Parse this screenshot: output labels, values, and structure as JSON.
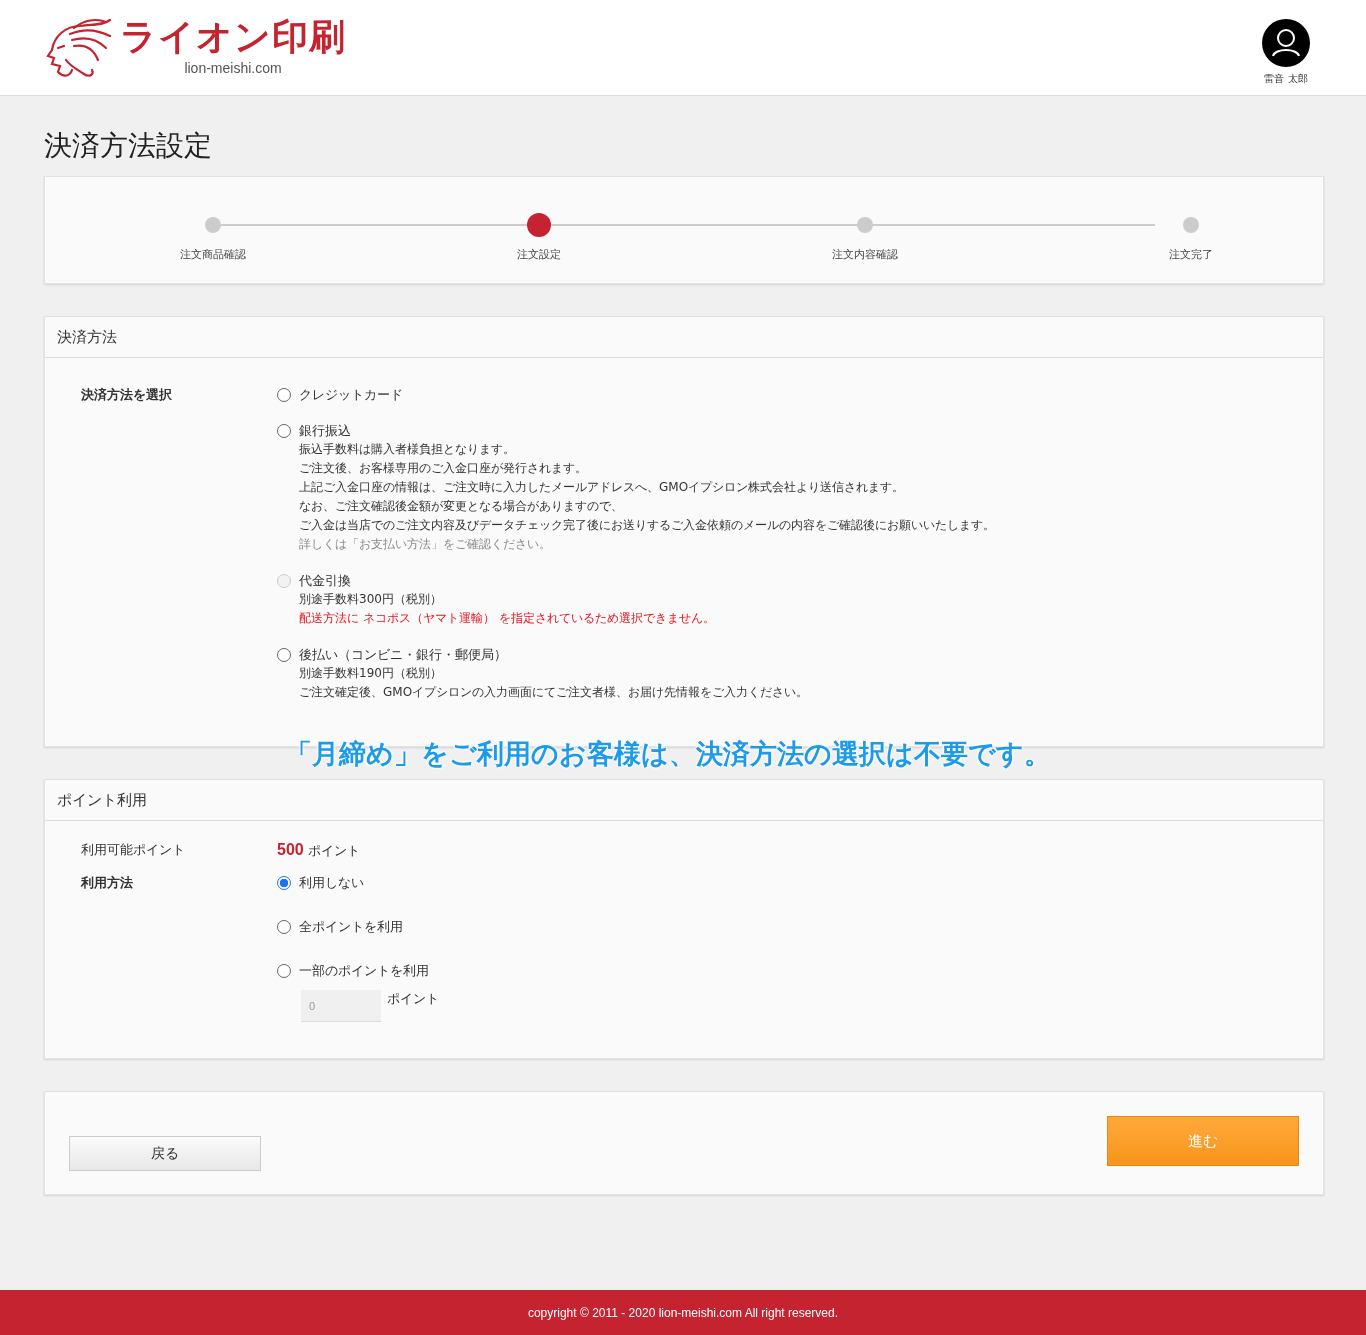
{
  "header": {
    "brand": "ライオン印刷",
    "domain": "lion-meishi.com",
    "user_name": "雷音 太郎"
  },
  "page_title": "決済方法設定",
  "steps": [
    {
      "label": "注文商品確認",
      "selected": false
    },
    {
      "label": "注文設定",
      "selected": true
    },
    {
      "label": "注文内容確認",
      "selected": false
    },
    {
      "label": "注文完了",
      "selected": false
    }
  ],
  "payment": {
    "heading": "決済方法",
    "field_label": "決済方法を選択",
    "options": [
      {
        "label": "クレジットカード",
        "selected": false,
        "disabled": false
      },
      {
        "label": "銀行振込",
        "selected": false,
        "disabled": false,
        "notes": [
          {
            "kind": "plain",
            "text": "振込手数料は購入者様負担となります。"
          },
          {
            "kind": "plain",
            "text": "ご注文後、お客様専用のご入金口座が発行されます。"
          },
          {
            "kind": "plain",
            "text": "上記ご入金口座の情報は、ご注文時に入力したメールアドレスへ、GMOイプシロン株式会社より送信されます。"
          },
          {
            "kind": "plain",
            "text": "なお、ご注文確認後金額が変更となる場合がありますので、"
          },
          {
            "kind": "plain",
            "text": "ご入金は当店でのご注文内容及びデータチェック完了後にお送りするご入金依頼のメールの内容をご確認後にお願いいたします。"
          },
          {
            "kind": "muted",
            "text": "詳しくは「お支払い方法」をご確認ください。"
          }
        ]
      },
      {
        "label": "代金引換",
        "selected": false,
        "disabled": true,
        "notes": [
          {
            "kind": "plain",
            "text": "別途手数料300円（税別）"
          },
          {
            "kind": "warning",
            "text": "配送方法に ネコポス（ヤマト運輸） を指定されているため選択できません。"
          }
        ]
      },
      {
        "label": "後払い（コンビニ・銀行・郵便局）",
        "selected": false,
        "disabled": false,
        "notes": [
          {
            "kind": "plain",
            "text": "別途手数料190円（税別）"
          },
          {
            "kind": "plain",
            "text": "ご注文確定後、GMOイプシロンの入力画面にてご注文者様、お届け先情報をご入力ください。"
          }
        ]
      }
    ]
  },
  "notice": "「月締め」をご利用のお客様は、決済方法の選択は不要です。",
  "points": {
    "heading": "ポイント利用",
    "available_label": "利用可能ポイント",
    "available_value": "500",
    "available_unit": "ポイント",
    "method_label": "利用方法",
    "options": [
      {
        "label": "利用しない",
        "selected": true
      },
      {
        "label": "全ポイントを利用",
        "selected": false
      },
      {
        "label": "一部のポイントを利用",
        "selected": false,
        "input": {
          "placeholder": "0",
          "unit": "ポイント"
        }
      }
    ]
  },
  "buttons": {
    "back": "戻る",
    "next": "進む"
  },
  "footer": "copyright © 2011 - 2020 lion-meishi.com All right reserved."
}
